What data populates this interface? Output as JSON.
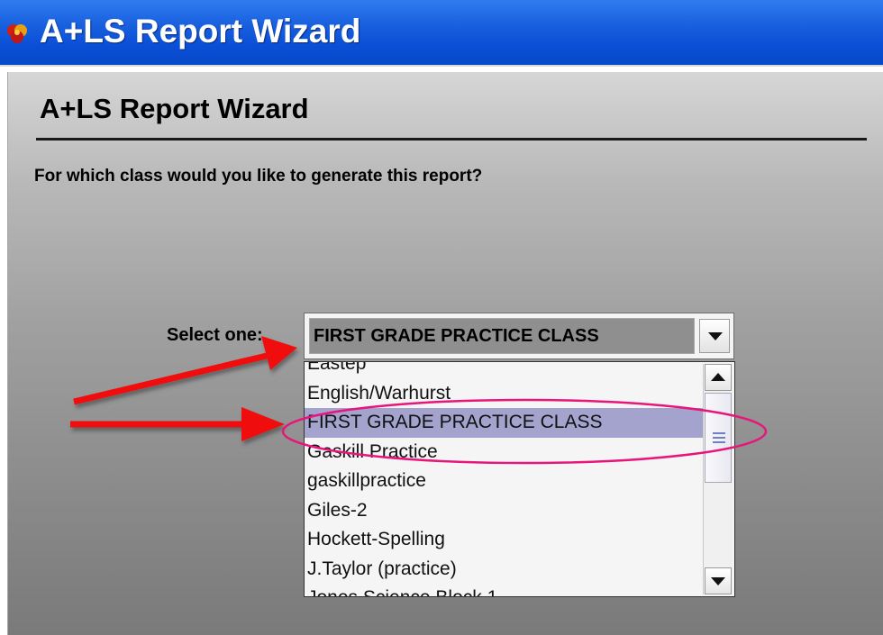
{
  "window": {
    "title": "A+LS Report Wizard",
    "icon": "app-logo-icon"
  },
  "wizard": {
    "header_title": "A+LS Report Wizard",
    "question": "For which class would you like to generate this report?",
    "select_label": "Select one:",
    "selected_value": "FIRST GRADE PRACTICE CLASS"
  },
  "dropdown": {
    "items": [
      "Eastep",
      "English/Warhurst",
      "FIRST GRADE PRACTICE CLASS",
      "Gaskill Practice",
      "gaskillpractice",
      "Giles-2",
      "Hockett-Spelling",
      "J.Taylor (practice)",
      "Jones Science Block 1"
    ],
    "highlighted_item": "FIRST GRADE PRACTICE CLASS"
  },
  "annotations": {
    "arrow_color": "#f01010",
    "ellipse_color": "#e8157a"
  },
  "colors": {
    "titlebar": "#0a4fd6",
    "selection": "#a3a3ce"
  }
}
